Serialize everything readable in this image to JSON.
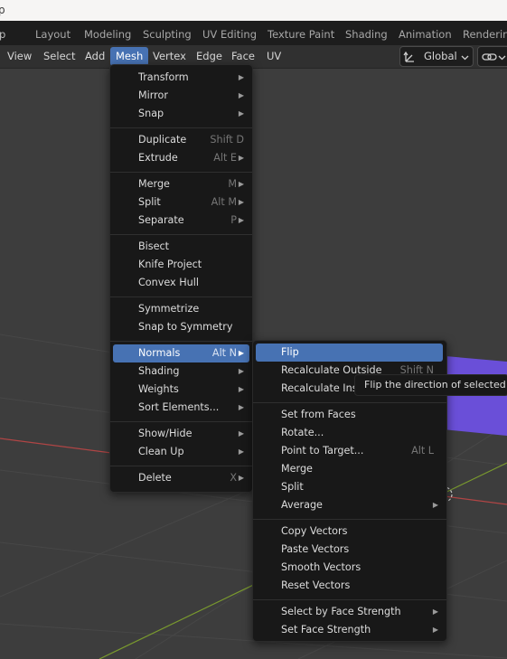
{
  "app": {
    "titlebar_left_glyph": "p",
    "workspace_tabs": [
      {
        "label": "Layout",
        "active": true
      },
      {
        "label": "Modeling",
        "active": false
      },
      {
        "label": "Sculpting",
        "active": false
      },
      {
        "label": "UV Editing",
        "active": false
      },
      {
        "label": "Texture Paint",
        "active": false
      },
      {
        "label": "Shading",
        "active": false
      },
      {
        "label": "Animation",
        "active": false
      },
      {
        "label": "Rendering",
        "active": false
      }
    ],
    "header_menus": [
      {
        "label": "View"
      },
      {
        "label": "Select"
      },
      {
        "label": "Add"
      },
      {
        "label": "Mesh",
        "active": true
      },
      {
        "label": "Vertex"
      },
      {
        "label": "Edge"
      },
      {
        "label": "Face"
      },
      {
        "label": "UV"
      }
    ],
    "transform_orientation": "Global"
  },
  "mesh_menu": [
    {
      "label": "Transform",
      "submenu": true
    },
    {
      "label": "Mirror",
      "submenu": true
    },
    {
      "label": "Snap",
      "submenu": true
    },
    {
      "separator": true
    },
    {
      "label": "Duplicate",
      "shortcut": "Shift D"
    },
    {
      "label": "Extrude",
      "shortcut": "Alt E",
      "submenu": true
    },
    {
      "separator": true
    },
    {
      "label": "Merge",
      "shortcut": "M",
      "submenu": true
    },
    {
      "label": "Split",
      "shortcut": "Alt M",
      "submenu": true
    },
    {
      "label": "Separate",
      "shortcut": "P",
      "submenu": true
    },
    {
      "separator": true
    },
    {
      "label": "Bisect"
    },
    {
      "label": "Knife Project"
    },
    {
      "label": "Convex Hull"
    },
    {
      "separator": true
    },
    {
      "label": "Symmetrize"
    },
    {
      "label": "Snap to Symmetry"
    },
    {
      "separator": true
    },
    {
      "label": "Normals",
      "shortcut": "Alt N",
      "submenu": true,
      "highlighted": true
    },
    {
      "label": "Shading",
      "submenu": true
    },
    {
      "label": "Weights",
      "submenu": true
    },
    {
      "label": "Sort Elements...",
      "submenu": true
    },
    {
      "separator": true
    },
    {
      "label": "Show/Hide",
      "submenu": true
    },
    {
      "label": "Clean Up",
      "submenu": true
    },
    {
      "separator": true
    },
    {
      "label": "Delete",
      "shortcut": "X",
      "submenu": true
    }
  ],
  "normals_menu": [
    {
      "label": "Flip",
      "highlighted": true
    },
    {
      "label": "Recalculate Outside",
      "shortcut": "Shift N"
    },
    {
      "label": "Recalculate Inside"
    },
    {
      "separator": true
    },
    {
      "label": "Set from Faces"
    },
    {
      "label": "Rotate..."
    },
    {
      "label": "Point to Target...",
      "shortcut": "Alt L"
    },
    {
      "label": "Merge"
    },
    {
      "label": "Split"
    },
    {
      "label": "Average",
      "submenu": true
    },
    {
      "separator": true
    },
    {
      "label": "Copy Vectors"
    },
    {
      "label": "Paste Vectors"
    },
    {
      "label": "Smooth Vectors"
    },
    {
      "label": "Reset Vectors"
    },
    {
      "separator": true
    },
    {
      "label": "Select by Face Strength",
      "submenu": true
    },
    {
      "label": "Set Face Strength",
      "submenu": true
    }
  ],
  "tooltip": {
    "text": "Flip the direction of selected faces' normals"
  },
  "colors": {
    "accent": "#4772b3",
    "selected_face": "#6a4fd8",
    "x_axis": "#b04545",
    "y_axis": "#7a9a2e"
  }
}
